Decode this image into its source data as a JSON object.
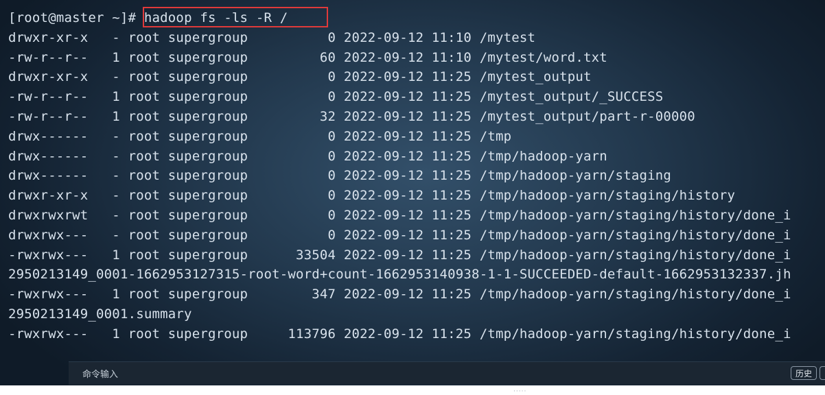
{
  "terminal": {
    "prompt": "[root@master ~]# ",
    "command": "hadoop fs -ls -R /",
    "lines": [
      "drwxr-xr-x   - root supergroup          0 2022-09-12 11:10 /mytest",
      "-rw-r--r--   1 root supergroup         60 2022-09-12 11:10 /mytest/word.txt",
      "drwxr-xr-x   - root supergroup          0 2022-09-12 11:25 /mytest_output",
      "-rw-r--r--   1 root supergroup          0 2022-09-12 11:25 /mytest_output/_SUCCESS",
      "-rw-r--r--   1 root supergroup         32 2022-09-12 11:25 /mytest_output/part-r-00000",
      "drwx------   - root supergroup          0 2022-09-12 11:25 /tmp",
      "drwx------   - root supergroup          0 2022-09-12 11:25 /tmp/hadoop-yarn",
      "drwx------   - root supergroup          0 2022-09-12 11:25 /tmp/hadoop-yarn/staging",
      "drwxr-xr-x   - root supergroup          0 2022-09-12 11:25 /tmp/hadoop-yarn/staging/history",
      "drwxrwxrwt   - root supergroup          0 2022-09-12 11:25 /tmp/hadoop-yarn/staging/history/done_i",
      "drwxrwx---   - root supergroup          0 2022-09-12 11:25 /tmp/hadoop-yarn/staging/history/done_i",
      "-rwxrwx---   1 root supergroup      33504 2022-09-12 11:25 /tmp/hadoop-yarn/staging/history/done_i",
      "2950213149_0001-1662953127315-root-word+count-1662953140938-1-1-SUCCEEDED-default-1662953132337.jh",
      "-rwxrwx---   1 root supergroup        347 2022-09-12 11:25 /tmp/hadoop-yarn/staging/history/done_i",
      "2950213149_0001.summary",
      "-rwxrwx---   1 root supergroup     113796 2022-09-12 11:25 /tmp/hadoop-yarn/staging/history/done_i"
    ]
  },
  "command_bar": {
    "placeholder": "命令输入",
    "history_label": "历史"
  },
  "colors": {
    "highlight_box": "#e03a3a",
    "text": "#d8e2ec"
  }
}
